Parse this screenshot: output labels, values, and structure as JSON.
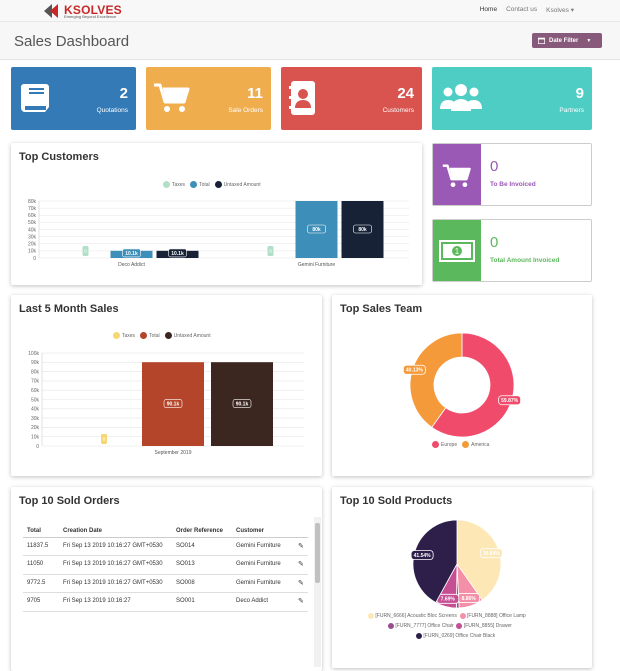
{
  "nav": {
    "brand": "KSOLVES",
    "tagline": "Emerging Beyond Excellence",
    "links": [
      "Home",
      "Contact us"
    ],
    "user": "Ksolves"
  },
  "header": {
    "title": "Sales Dashboard",
    "date_filter": "Date Filter"
  },
  "cards": [
    {
      "value": "2",
      "label": "Quotations",
      "color": "#337ab7",
      "icon": "book-icon"
    },
    {
      "value": "11",
      "label": "Sale Orders",
      "color": "#f0ad4e",
      "icon": "cart-icon"
    },
    {
      "value": "24",
      "label": "Customers",
      "color": "#d9534f",
      "icon": "address-book-icon"
    },
    {
      "value": "9",
      "label": "Partners",
      "color": "#4ecdc4",
      "icon": "users-icon"
    }
  ],
  "invoice": [
    {
      "value": "0",
      "label": "To Be Invoiced",
      "color": "#9b59b6",
      "icon": "cart-icon"
    },
    {
      "value": "0",
      "label": "Total Amount Invoiced",
      "color": "#5cb85c",
      "icon": "money-icon"
    }
  ],
  "top_customers": {
    "title": "Top Customers",
    "legend": [
      "Taxes",
      "Total",
      "Untaxed Amount"
    ],
    "colors": [
      "#b2dfc7",
      "#3d8eb9",
      "#172236"
    ]
  },
  "last5": {
    "title": "Last 5 Month Sales",
    "legend": [
      "Taxes",
      "Total",
      "Untaxed Amount"
    ],
    "colors": [
      "#f7d774",
      "#b5452a",
      "#3b2620"
    ]
  },
  "team": {
    "title": "Top Sales Team",
    "legend": [
      "Europe",
      "America"
    ],
    "colors": [
      "#f14b6b",
      "#f59a3a"
    ]
  },
  "orders": {
    "title": "Top 10 Sold Orders",
    "headers": [
      "Total",
      "Creation Date",
      "Order Reference",
      "Customer"
    ],
    "rows": [
      {
        "total": "11837.5",
        "date": "Fri Sep 13 2019 10:16:27 GMT+0530",
        "ref": "SO014",
        "customer": "Gemini Furniture"
      },
      {
        "total": "11050",
        "date": "Fri Sep 13 2019 10:16:27 GMT+0530",
        "ref": "SO013",
        "customer": "Gemini Furniture"
      },
      {
        "total": "9772.5",
        "date": "Fri Sep 13 2019 10:16:27 GMT+0530",
        "ref": "SO008",
        "customer": "Gemini Furniture"
      },
      {
        "total": "9705",
        "date": "Fri Sep 13 2019 10:16:27",
        "ref": "SO001",
        "customer": "Deco Addict"
      }
    ]
  },
  "products": {
    "title": "Top 10 Sold Products",
    "legend": [
      "[FURN_6666] Acoustic Bloc Screens",
      "[FURN_8888] Office Lamp",
      "[FURN_7777] Office Chair",
      "[FURN_8855] Drawer",
      "[FURN_0269] Office Chair Black"
    ],
    "colors": [
      "#fde7b5",
      "#f38fa6",
      "#9a4e8f",
      "#c64f93",
      "#2e1f4a"
    ]
  },
  "chart_data": [
    {
      "type": "bar",
      "title": "Top Customers",
      "categories": [
        "Deco Addict",
        "Gemini Furniture"
      ],
      "series": [
        {
          "name": "Taxes",
          "values": [
            0,
            0
          ],
          "labels": [
            "0",
            "0"
          ]
        },
        {
          "name": "Total",
          "values": [
            10100,
            80000
          ],
          "labels": [
            "10.1k",
            "80k"
          ]
        },
        {
          "name": "Untaxed Amount",
          "values": [
            10100,
            80000
          ],
          "labels": [
            "10.1k",
            "80k"
          ]
        }
      ],
      "yticks": [
        "80k",
        "70k",
        "60k",
        "50k",
        "40k",
        "30k",
        "20k",
        "10k",
        "0"
      ],
      "ylim": [
        0,
        80000
      ]
    },
    {
      "type": "bar",
      "title": "Last 5 Month Sales",
      "categories": [
        "September 2019"
      ],
      "series": [
        {
          "name": "Taxes",
          "values": [
            0
          ],
          "labels": [
            "0"
          ]
        },
        {
          "name": "Total",
          "values": [
            90100
          ],
          "labels": [
            "90.1k"
          ]
        },
        {
          "name": "Untaxed Amount",
          "values": [
            90100
          ],
          "labels": [
            "90.1k"
          ]
        }
      ],
      "yticks": [
        "100k",
        "90k",
        "80k",
        "70k",
        "60k",
        "50k",
        "40k",
        "30k",
        "20k",
        "10k",
        "0"
      ],
      "ylim": [
        0,
        100000
      ]
    },
    {
      "type": "pie",
      "title": "Top Sales Team",
      "categories": [
        "Europe",
        "America"
      ],
      "values": [
        59.87,
        40.13
      ],
      "labels": [
        "59.87%",
        "40.13%"
      ]
    },
    {
      "type": "pie",
      "title": "Top 10 Sold Products",
      "categories": [
        "[FURN_6666] Acoustic Bloc Screens",
        "[FURN_8888] Office Lamp",
        "[FURN_7777] Office Chair",
        "[FURN_8855] Drawer",
        "[FURN_0269] Office Chair Black"
      ],
      "values": [
        39.84,
        8.86,
        1.0,
        7.69,
        41.54
      ],
      "labels": [
        "39.84%",
        "8.86%",
        "",
        "7.69%",
        "41.54%"
      ]
    }
  ]
}
